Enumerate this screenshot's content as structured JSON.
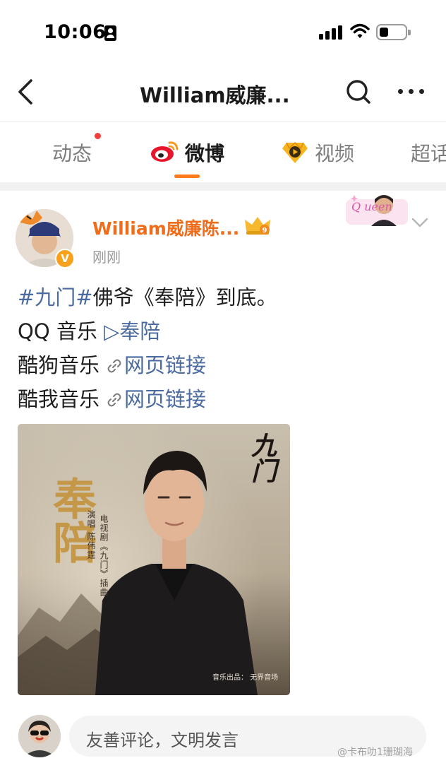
{
  "status_bar": {
    "time": "10:06",
    "icons": [
      "id-card-icon",
      "signal-icon",
      "wifi-icon",
      "battery-icon"
    ]
  },
  "nav": {
    "title": "William威廉...",
    "icons": [
      "back-icon",
      "search-icon",
      "more-icon"
    ]
  },
  "tabs": [
    {
      "label": "动态",
      "active": false,
      "has_dot": true
    },
    {
      "label": "微博",
      "active": true,
      "icon": "weibo-icon"
    },
    {
      "label": "视频",
      "active": false,
      "icon": "video-icon"
    },
    {
      "label": "超话",
      "active": false
    }
  ],
  "post": {
    "author": "William威廉陈...",
    "verified_badge": "V",
    "vip_level": "9",
    "time": "刚刚",
    "hashtag": "#九门#",
    "text": "佛爷《奉陪》到底。",
    "lines": [
      {
        "label": "QQ 音乐",
        "link_prefix": "▷",
        "link": "奉陪"
      },
      {
        "label": "酷狗音乐",
        "link_icon": "link-icon",
        "link": "网页链接"
      },
      {
        "label": "酷我音乐",
        "link_icon": "link-icon",
        "link": "网页链接"
      }
    ],
    "album": {
      "title": "奉陪",
      "sub_left": "电视剧《九门》插曲",
      "sub_right": "演唱 陈伟霆",
      "corner_logo": "九门",
      "credit": "音乐出品：",
      "credit_brand": "无界音场"
    },
    "sticker": {
      "text": "Q ueen"
    }
  },
  "comment": {
    "placeholder": "友善评论，文明发言"
  },
  "watermark": "@卡布叻1珊瑚海",
  "colors": {
    "accent": "#ff7a1a",
    "author": "#ef6c1b",
    "link": "#4a6aa0",
    "dot": "#f03d3d",
    "album_title": "#c49848"
  }
}
